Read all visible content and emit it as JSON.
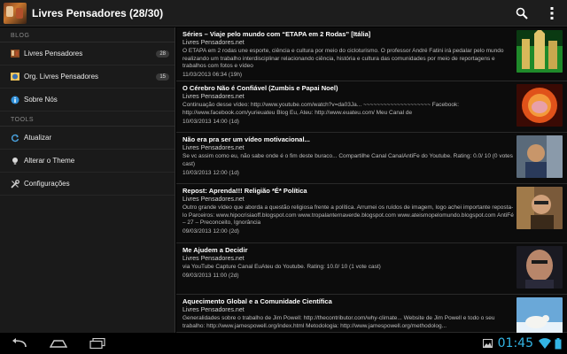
{
  "app": {
    "title": "Livres Pensadores (28/30)",
    "accent": "#33b5e5"
  },
  "actionbar": {
    "icons": [
      "search-icon",
      "overflow-menu-icon"
    ]
  },
  "sidebar": {
    "blog_header": "BLOG",
    "tools_header": "TOOLS",
    "items": [
      {
        "label": "Livres Pensadores",
        "badge": "28",
        "icon": "blog-thumb-icon"
      },
      {
        "label": "Org. Livres Pensadores",
        "badge": "15",
        "icon": "org-thumb-icon"
      },
      {
        "label": "Sobre Nós",
        "icon": "info-icon"
      }
    ],
    "tools": [
      {
        "label": "Atualizar",
        "icon": "refresh-icon"
      },
      {
        "label": "Alterar o Theme",
        "icon": "bulb-icon"
      },
      {
        "label": "Configurações",
        "icon": "settings-icon"
      }
    ]
  },
  "articles": [
    {
      "title": "Séries – Viaje pelo mundo com “ETAPA em 2 Rodas” [Itália]",
      "source": "Livres Pensadores.net",
      "desc": " O ETAPA em 2 rodas une esporte, ciência e cultura por meio do cicloturismo. O professor André Fatini  irá pedalar pelo mundo realizando um trabalho interdisciplinar relacionando ciência, história e cultura das comunidades por meio de reportagens e trabalhos com fotos e vídeo",
      "date": "11/03/2013 06:34 (19h)",
      "thumb": "italy-landmark"
    },
    {
      "title": "O Cérebro Não é Confiável (Zumbis e Papai Noel)",
      "source": "Livres Pensadores.net",
      "desc": "Continuação desse vídeo:  http://www.youtube.com/watch?v=da03Ja... ~~~~~~~~~~~~~~~~~~~~ Facebook: http://www.facebook.com/yurieuateu Blog Eu, Ateu: http://www.euateu.com/ Meu Canal de",
      "date": "10/03/2013 14:00 (1d)",
      "thumb": "brain-fire"
    },
    {
      "title": "Não era pra ser um vídeo motivacional...",
      "source": "Livres Pensadores.net",
      "desc": "Se vc assim como eu, não sabe onde é o fim deste buraco... Compartilhe Canal CanalAntiFe do Youtube. Rating: 0.0/ 10 (0 votes cast)",
      "date": "10/03/2013 12:00 (1d)",
      "thumb": "man-webcam"
    },
    {
      "title": "Repost: Aprenda!!! Religião *É* Política",
      "source": "Livres Pensadores.net",
      "desc": "Outro grande vídeo que aborda a questão religiosa frente a política. Arrumei os ruídos de imagem, logo achei importante reposta-lo Parceiros: www.hipocrisiaoff.blogspot.com  www.tropalanternaverde.blogspot.com www.ateismopelomundo.blogspot.com AntiFé – 27 – Preconceito, Ignorância",
      "date": "09/03/2013 12:00 (2d)",
      "thumb": "man-glasses"
    },
    {
      "title": "Me Ajudem a Decidir",
      "source": "Livres Pensadores.net",
      "desc": "via YouTube Capture Canal EuAteu do Youtube. Rating: 10.0/ 10 (1 vote cast)",
      "date": "09/03/2013 11:00 (2d)",
      "thumb": "man-face"
    },
    {
      "title": "Aquecimento Global e a Comunidade Científica",
      "source": "Livres Pensadores.net",
      "desc": "Generalidades sobre o trabalho de Jim Powell: http://thecontributor.com/why-climate... Website de Jim Powell e todo o seu trabalho: http://www.jamespowell.org/index.html Metodologia: http://www.jamespowell.org/methodolog...",
      "date": "",
      "thumb": "polar-bear"
    }
  ],
  "status": {
    "time": "01:45"
  }
}
